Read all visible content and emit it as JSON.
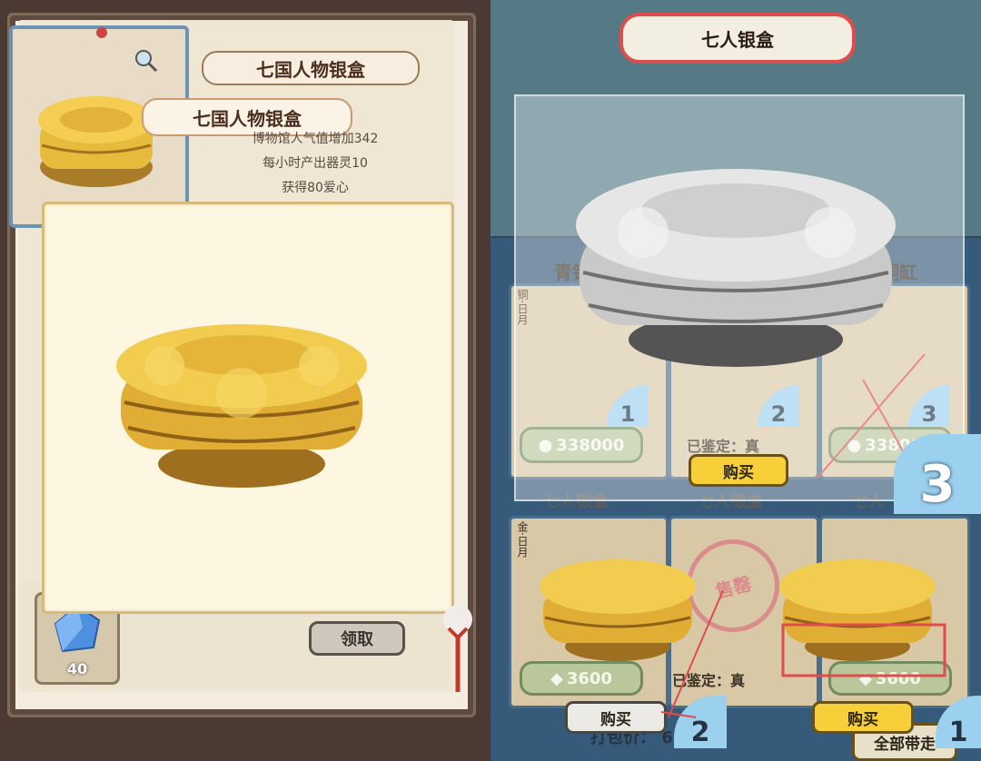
{
  "left_panel": {
    "item_card_title": "七国人物银盒",
    "ribbon_title": "七国人物银盒",
    "info_lines": [
      "博物馆人气值增加342",
      "每小时产出器灵10",
      "获得80爱心"
    ],
    "reward_count": "40",
    "claim_button": "领取"
  },
  "right_panel": {
    "header_title": "七人银盒",
    "category_left": "青铜",
    "category_right": "铜缸",
    "tag_side_1": "铜·日月",
    "tag_side_2": "金·日月",
    "top_row": {
      "price_left": "338000",
      "price_right": "338000",
      "status_mid": "已鉴定：真",
      "corner_left": "1",
      "corner_mid": "2",
      "corner_right": "3",
      "buy_label": "购买"
    },
    "mid_labels": [
      "七人银盒",
      "七人银盒",
      "七人"
    ],
    "big_corner": "3",
    "bottom_row": {
      "price_left": "3600",
      "status_mid": "已鉴定：真",
      "price_right": "3600",
      "buy_left": "购买",
      "buy_right": "购买",
      "corner_left": "2",
      "corner_right": "1",
      "stamp": "售罄"
    },
    "footer_label": "打包价：",
    "footer_value": "6500",
    "footer_button": "全部带走"
  },
  "colors": {
    "accent_red": "#e04b4b",
    "button_yellow": "#f7cf38",
    "card_border_blue": "#6b93b8"
  }
}
